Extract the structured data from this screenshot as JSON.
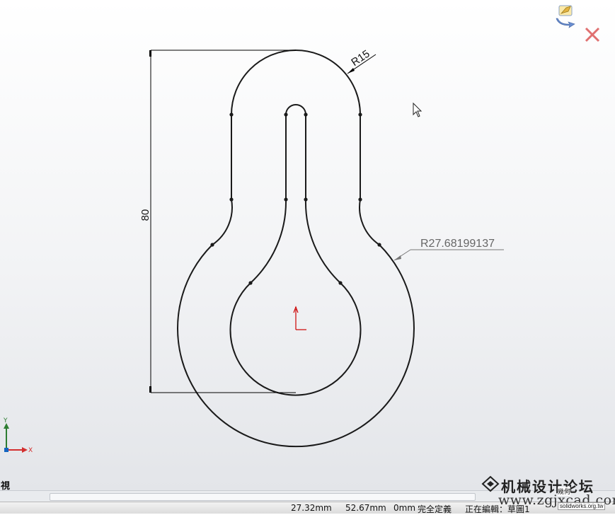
{
  "dimensions": {
    "height_label": "80",
    "small_radius_label": "R15",
    "large_radius_label": "R27.68199137"
  },
  "axes": {
    "x_label": "X",
    "y_label": "Y"
  },
  "view_label": "視",
  "status_bar": {
    "x_coord": "27.32mm",
    "y_coord": "52.67mm",
    "z_coord": "0mm",
    "sketch_state": "完全定義",
    "editing": "正在編輯：草圖1"
  },
  "watermark": {
    "title": "机械设计论坛",
    "url": "www.zgjxcad.com",
    "sub1": "幾何",
    "sub2": "solidworks.org.tw"
  },
  "colors": {
    "sketch_line": "#1a1a1a",
    "dimension_line": "#000000",
    "origin": "#cc0000",
    "triad_x": "#d32f2f",
    "triad_y": "#2e7d32",
    "triad_z": "#1565c0"
  },
  "icons": [
    "confirm-corner-icon",
    "exit-sketch-icon",
    "cursor-arrow-icon",
    "origin-icon"
  ]
}
